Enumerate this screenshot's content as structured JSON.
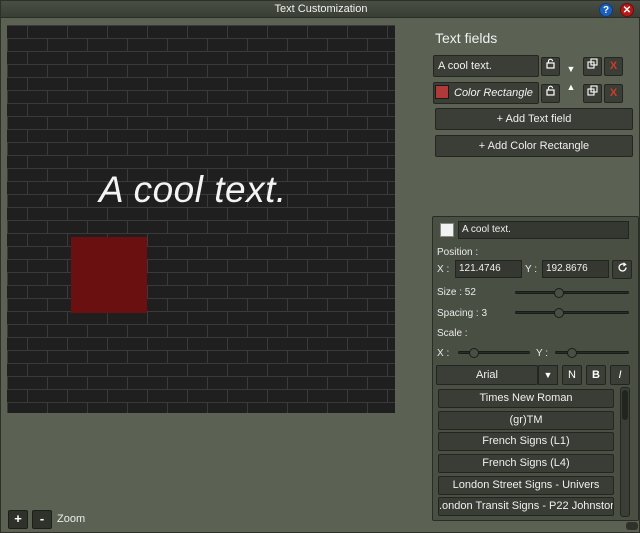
{
  "window": {
    "title": "Text Customization",
    "help_label": "?",
    "close_label": "✕"
  },
  "canvas": {
    "text": "A cool text.",
    "rect_color": "#6a1010"
  },
  "zoom": {
    "plus_label": "+",
    "minus_label": "-",
    "label": "Zoom"
  },
  "text_fields": {
    "title": "Text fields",
    "items": [
      {
        "label": "A cool text.",
        "delete_label": "X",
        "arrow": "▼"
      },
      {
        "label": "Color Rectangle",
        "color": "#b03a3a",
        "delete_label": "X",
        "arrow": "▲"
      }
    ],
    "add_text_label": "+ Add Text field",
    "add_rect_label": "+ Add Color Rectangle"
  },
  "props": {
    "text_value": "A cool text.",
    "position_label": "Position :",
    "x_label": "X :",
    "x_value": "121.4746",
    "y_label": "Y :",
    "y_value": "192.8676",
    "size_label": "Size : 52",
    "size_slider": 0.38,
    "spacing_label": "Spacing : 3",
    "spacing_slider": 0.38,
    "scale_label": "Scale :",
    "scale_x_label": "X :",
    "scale_x_slider": 0.22,
    "scale_y_label": "Y :",
    "scale_y_slider": 0.22,
    "font_selected": "Arial",
    "dropdown_arrow": "▼",
    "normal_label": "N",
    "bold_label": "B",
    "italic_label": "I",
    "font_options": [
      "Times New Roman",
      "(gr)TM",
      "French Signs (L1)",
      "French Signs (L4)",
      "London Street Signs - Univers",
      ".ondon Transit Signs - P22 Johnstor"
    ]
  }
}
